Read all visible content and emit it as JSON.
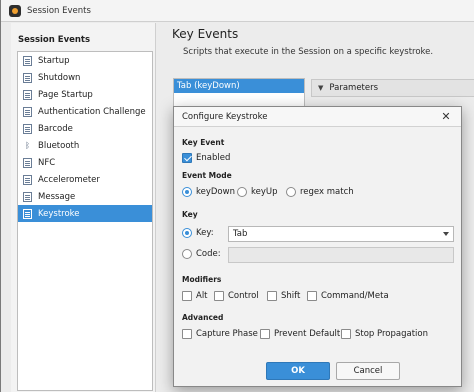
{
  "window": {
    "title": "Session Events"
  },
  "sidebar": {
    "title": "Session Events",
    "items": [
      {
        "label": "Startup",
        "icon": "page-icon"
      },
      {
        "label": "Shutdown",
        "icon": "page-icon"
      },
      {
        "label": "Page Startup",
        "icon": "page-icon"
      },
      {
        "label": "Authentication Challenge",
        "icon": "page-icon"
      },
      {
        "label": "Barcode",
        "icon": "page-icon"
      },
      {
        "label": "Bluetooth",
        "icon": "bluetooth-icon"
      },
      {
        "label": "NFC",
        "icon": "page-icon"
      },
      {
        "label": "Accelerometer",
        "icon": "page-icon"
      },
      {
        "label": "Message",
        "icon": "page-icon"
      },
      {
        "label": "Keystroke",
        "icon": "page-icon",
        "selected": true
      }
    ]
  },
  "main": {
    "title": "Key Events",
    "subtitle": "Scripts that execute in the Session on a specific keystroke.",
    "events": [
      "Tab (keyDown)"
    ],
    "params_label": "Parameters"
  },
  "dialog": {
    "title": "Configure Keystroke",
    "key_event": {
      "label": "Key Event",
      "enabled_label": "Enabled",
      "enabled": true
    },
    "event_mode": {
      "label": "Event Mode",
      "options": [
        "keyDown",
        "keyUp",
        "regex match"
      ],
      "selected": "keyDown"
    },
    "key": {
      "label": "Key",
      "key_option": "Key:",
      "key_value": "Tab",
      "code_option": "Code:",
      "code_value": "",
      "selected": "Key:"
    },
    "modifiers": {
      "label": "Modifiers",
      "options": [
        "Alt",
        "Control",
        "Shift",
        "Command/Meta"
      ]
    },
    "advanced": {
      "label": "Advanced",
      "options": [
        "Capture Phase",
        "Prevent Default",
        "Stop Propagation"
      ]
    },
    "ok_label": "OK",
    "cancel_label": "Cancel"
  }
}
